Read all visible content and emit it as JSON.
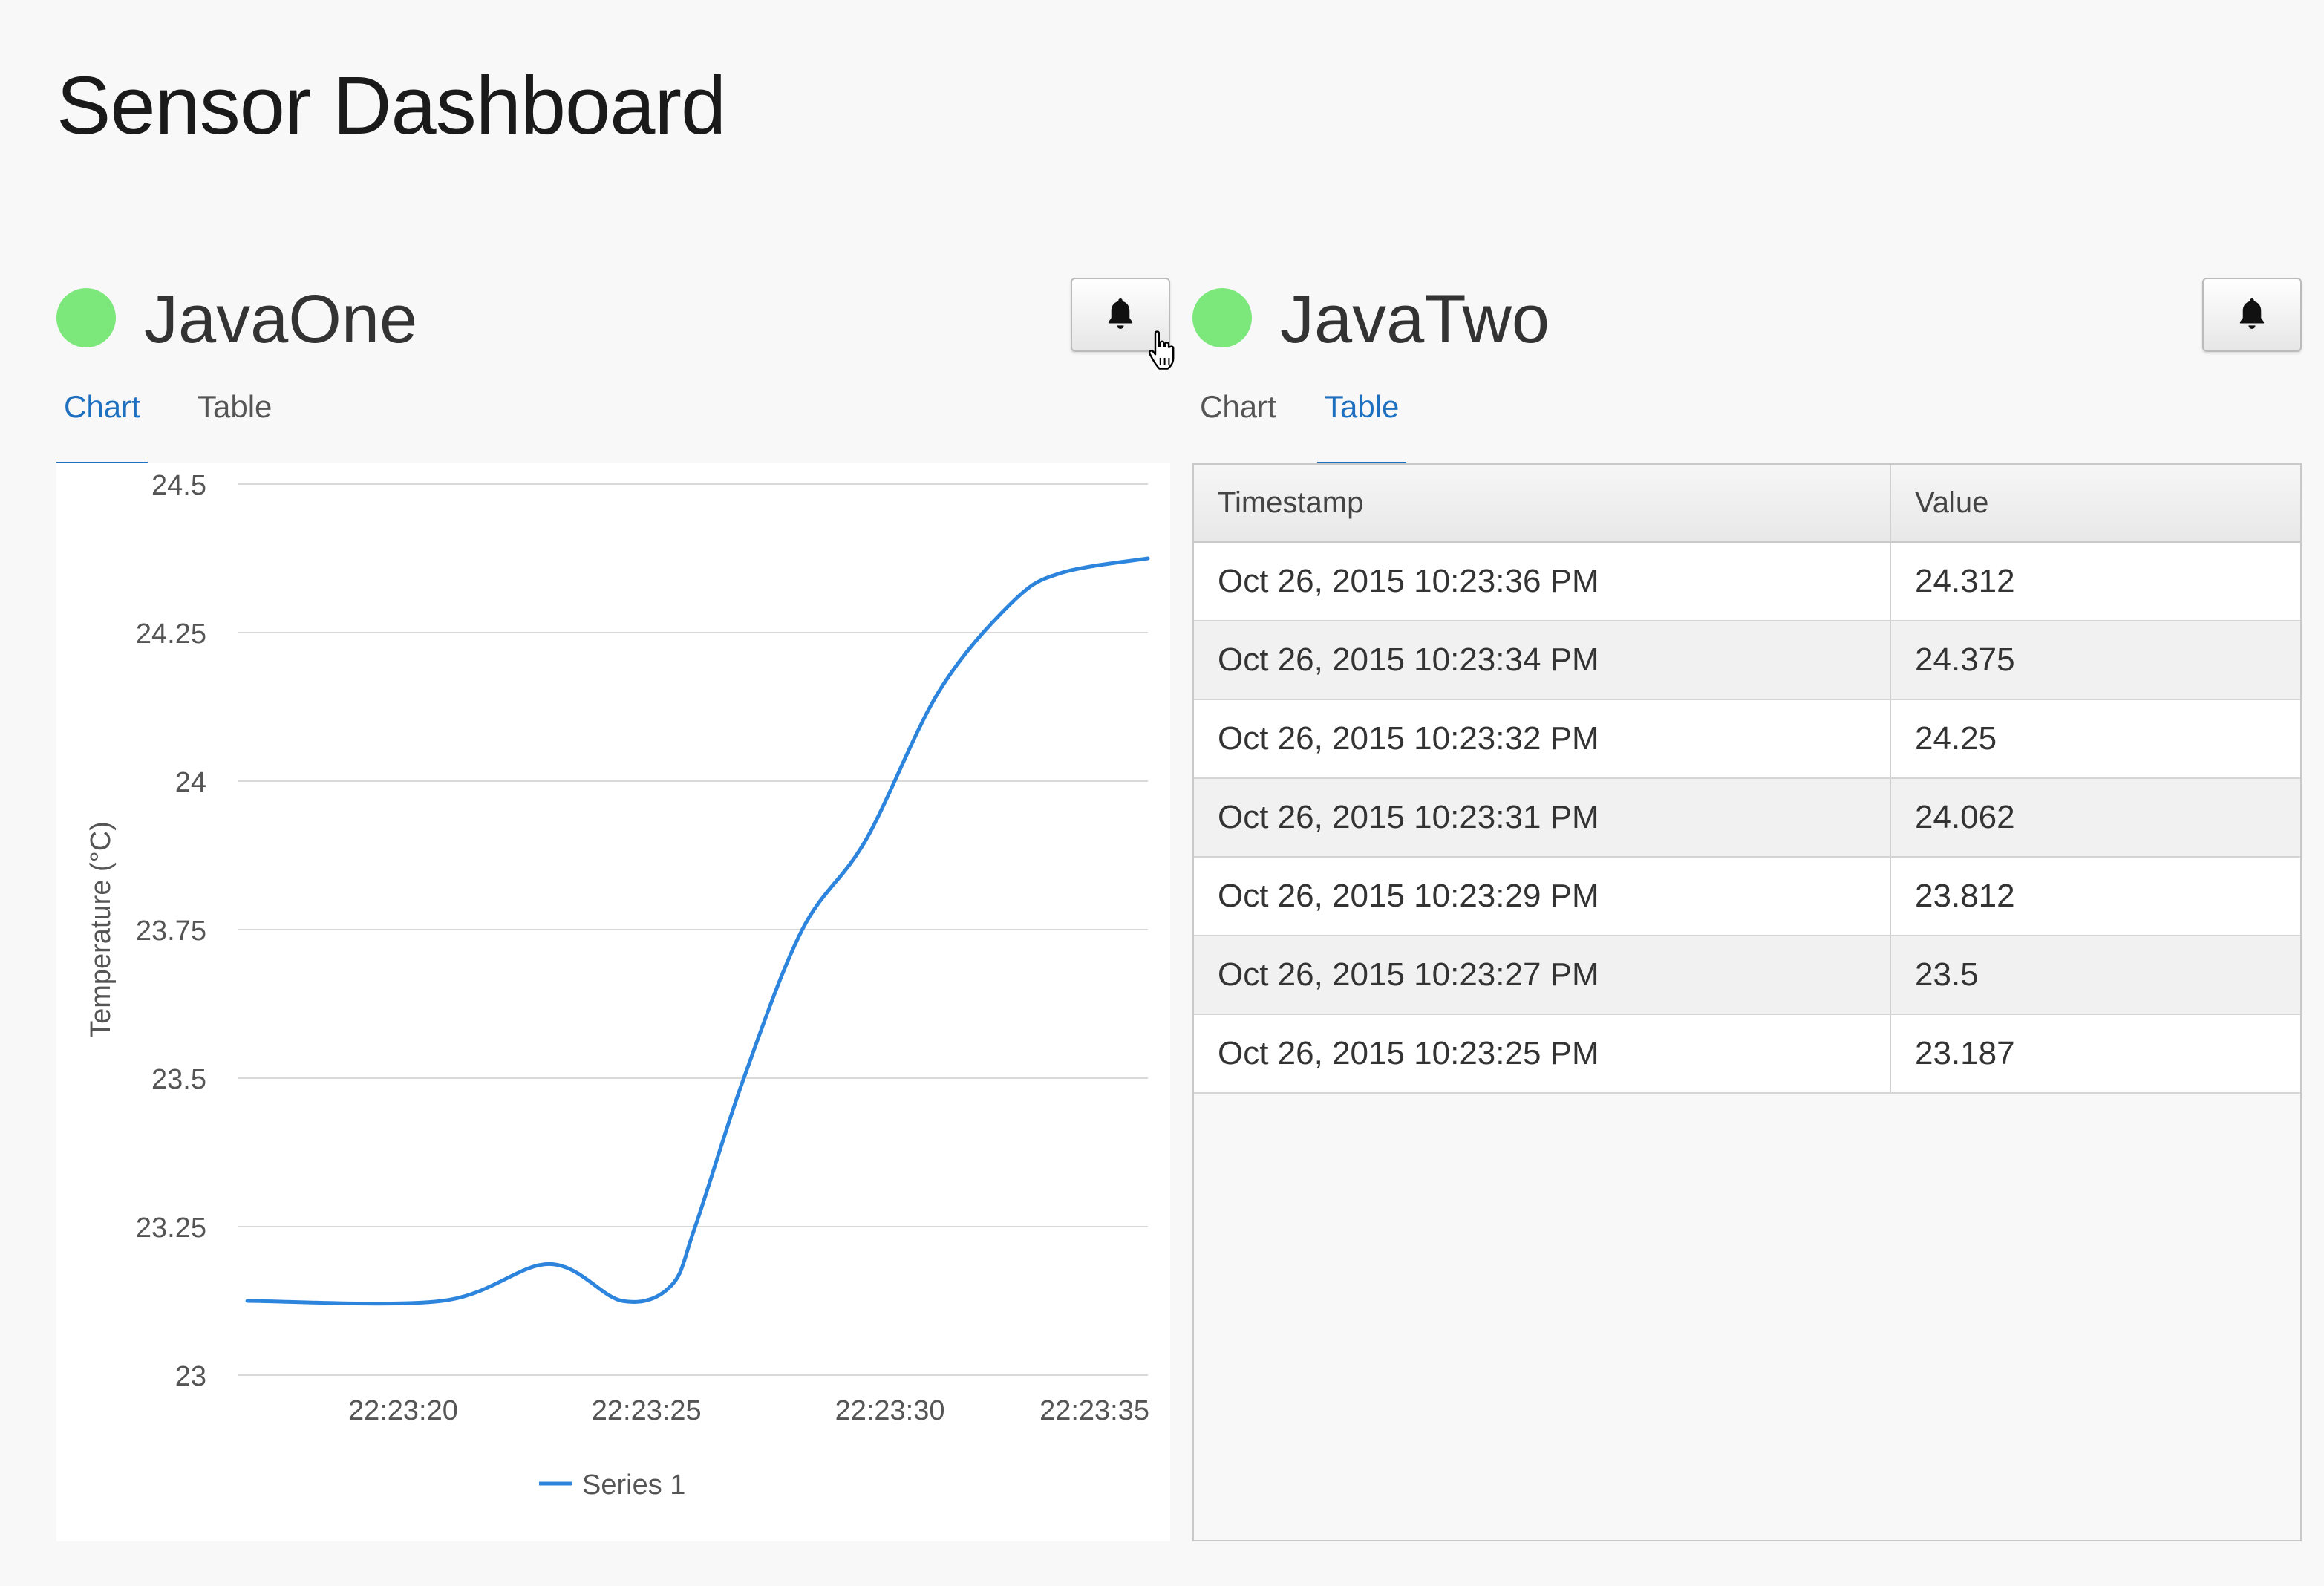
{
  "page": {
    "title": "Sensor Dashboard"
  },
  "colors": {
    "status_online": "#7ce87c",
    "accent": "#1d6fbf",
    "series_line": "#2c84dc"
  },
  "panels": [
    {
      "name": "JavaOne",
      "status": "online",
      "bell_icon": "bell-icon",
      "tabs": [
        "Chart",
        "Table"
      ],
      "active_tab": "Chart"
    },
    {
      "name": "JavaTwo",
      "status": "online",
      "bell_icon": "bell-icon",
      "tabs": [
        "Chart",
        "Table"
      ],
      "active_tab": "Table",
      "table": {
        "headers": [
          "Timestamp",
          "Value"
        ],
        "rows": [
          [
            "Oct 26, 2015 10:23:36 PM",
            "24.312"
          ],
          [
            "Oct 26, 2015 10:23:34 PM",
            "24.375"
          ],
          [
            "Oct 26, 2015 10:23:32 PM",
            "24.25"
          ],
          [
            "Oct 26, 2015 10:23:31 PM",
            "24.062"
          ],
          [
            "Oct 26, 2015 10:23:29 PM",
            "23.812"
          ],
          [
            "Oct 26, 2015 10:23:27 PM",
            "23.5"
          ],
          [
            "Oct 26, 2015 10:23:25 PM",
            "23.187"
          ]
        ]
      }
    }
  ],
  "chart_data": {
    "type": "line",
    "ylabel": "Temperature (°C)",
    "xlabel": "",
    "ylim": [
      23,
      24.5
    ],
    "yticks": [
      "24.5",
      "24.25",
      "24",
      "23.75",
      "23.5",
      "23.25",
      "23"
    ],
    "xticks": [
      "22:23:20",
      "22:23:25",
      "22:23:30",
      "22:23:35"
    ],
    "xlim": [
      "22:23:16.6",
      "22:23:35.3"
    ],
    "grid": true,
    "legend_position": "bottom",
    "series": [
      {
        "name": "Series 1",
        "x": [
          "22:23:16.8",
          "22:23:20.8",
          "22:23:23.0",
          "22:23:24.5",
          "22:23:25.5",
          "22:23:26.0",
          "22:23:27.0",
          "22:23:28.2",
          "22:23:29.5",
          "22:23:31.0",
          "22:23:32.5",
          "22:23:33.5",
          "22:23:35.3"
        ],
        "y": [
          23.125,
          23.125,
          23.187,
          23.125,
          23.15,
          23.25,
          23.5,
          23.75,
          23.9,
          24.15,
          24.3,
          24.35,
          24.375
        ]
      }
    ]
  }
}
